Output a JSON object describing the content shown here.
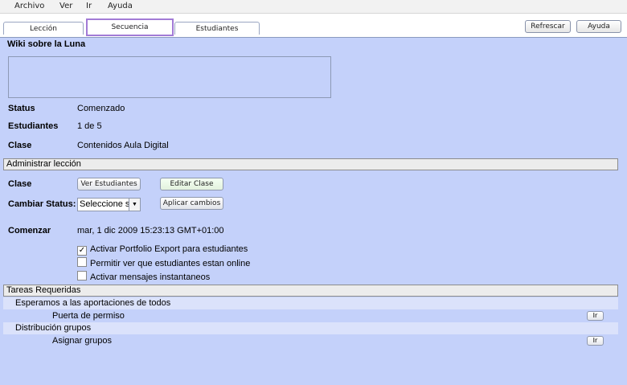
{
  "menu": [
    "Archivo",
    "Ver",
    "Ir",
    "Ayuda"
  ],
  "tabs": [
    {
      "label": "Lección",
      "selected": false
    },
    {
      "label": "Secuencia",
      "selected": true
    },
    {
      "label": "Estudiantes",
      "selected": false
    }
  ],
  "header_buttons": {
    "refresh": "Refrescar",
    "help": "Ayuda"
  },
  "lesson_title": "Wiki sobre la Luna",
  "info": {
    "status_label": "Status",
    "status_value": "Comenzado",
    "students_label": "Estudiantes",
    "students_value": "1 de 5",
    "class_label": "Clase",
    "class_value": "Contenidos Aula Digital"
  },
  "admin": {
    "section_title": "Administrar lección",
    "class_label": "Clase",
    "view_students": "Ver Estudiantes",
    "edit_class": "Editar Clase",
    "change_status_label": "Cambiar Status:",
    "status_select": "Seleccione st",
    "apply_changes": "Aplicar cambios",
    "start_label": "Comenzar",
    "start_value": "mar, 1 dic 2009 15:23:13 GMT+01:00",
    "options": [
      {
        "label": "Activar Portfolio Export para estudiantes",
        "checked": true
      },
      {
        "label": "Permitir ver que estudiantes estan online",
        "checked": false
      },
      {
        "label": "Activar mensajes instantaneos",
        "checked": false
      }
    ]
  },
  "tasks": {
    "section_title": "Tareas Requeridas",
    "groups": [
      {
        "name": "Esperamos a las aportaciones de todos",
        "items": [
          {
            "name": "Puerta de permiso",
            "button": "Ir"
          }
        ]
      },
      {
        "name": "Distribución grupos",
        "items": [
          {
            "name": "Asignar grupos",
            "button": "Ir"
          }
        ]
      }
    ]
  }
}
